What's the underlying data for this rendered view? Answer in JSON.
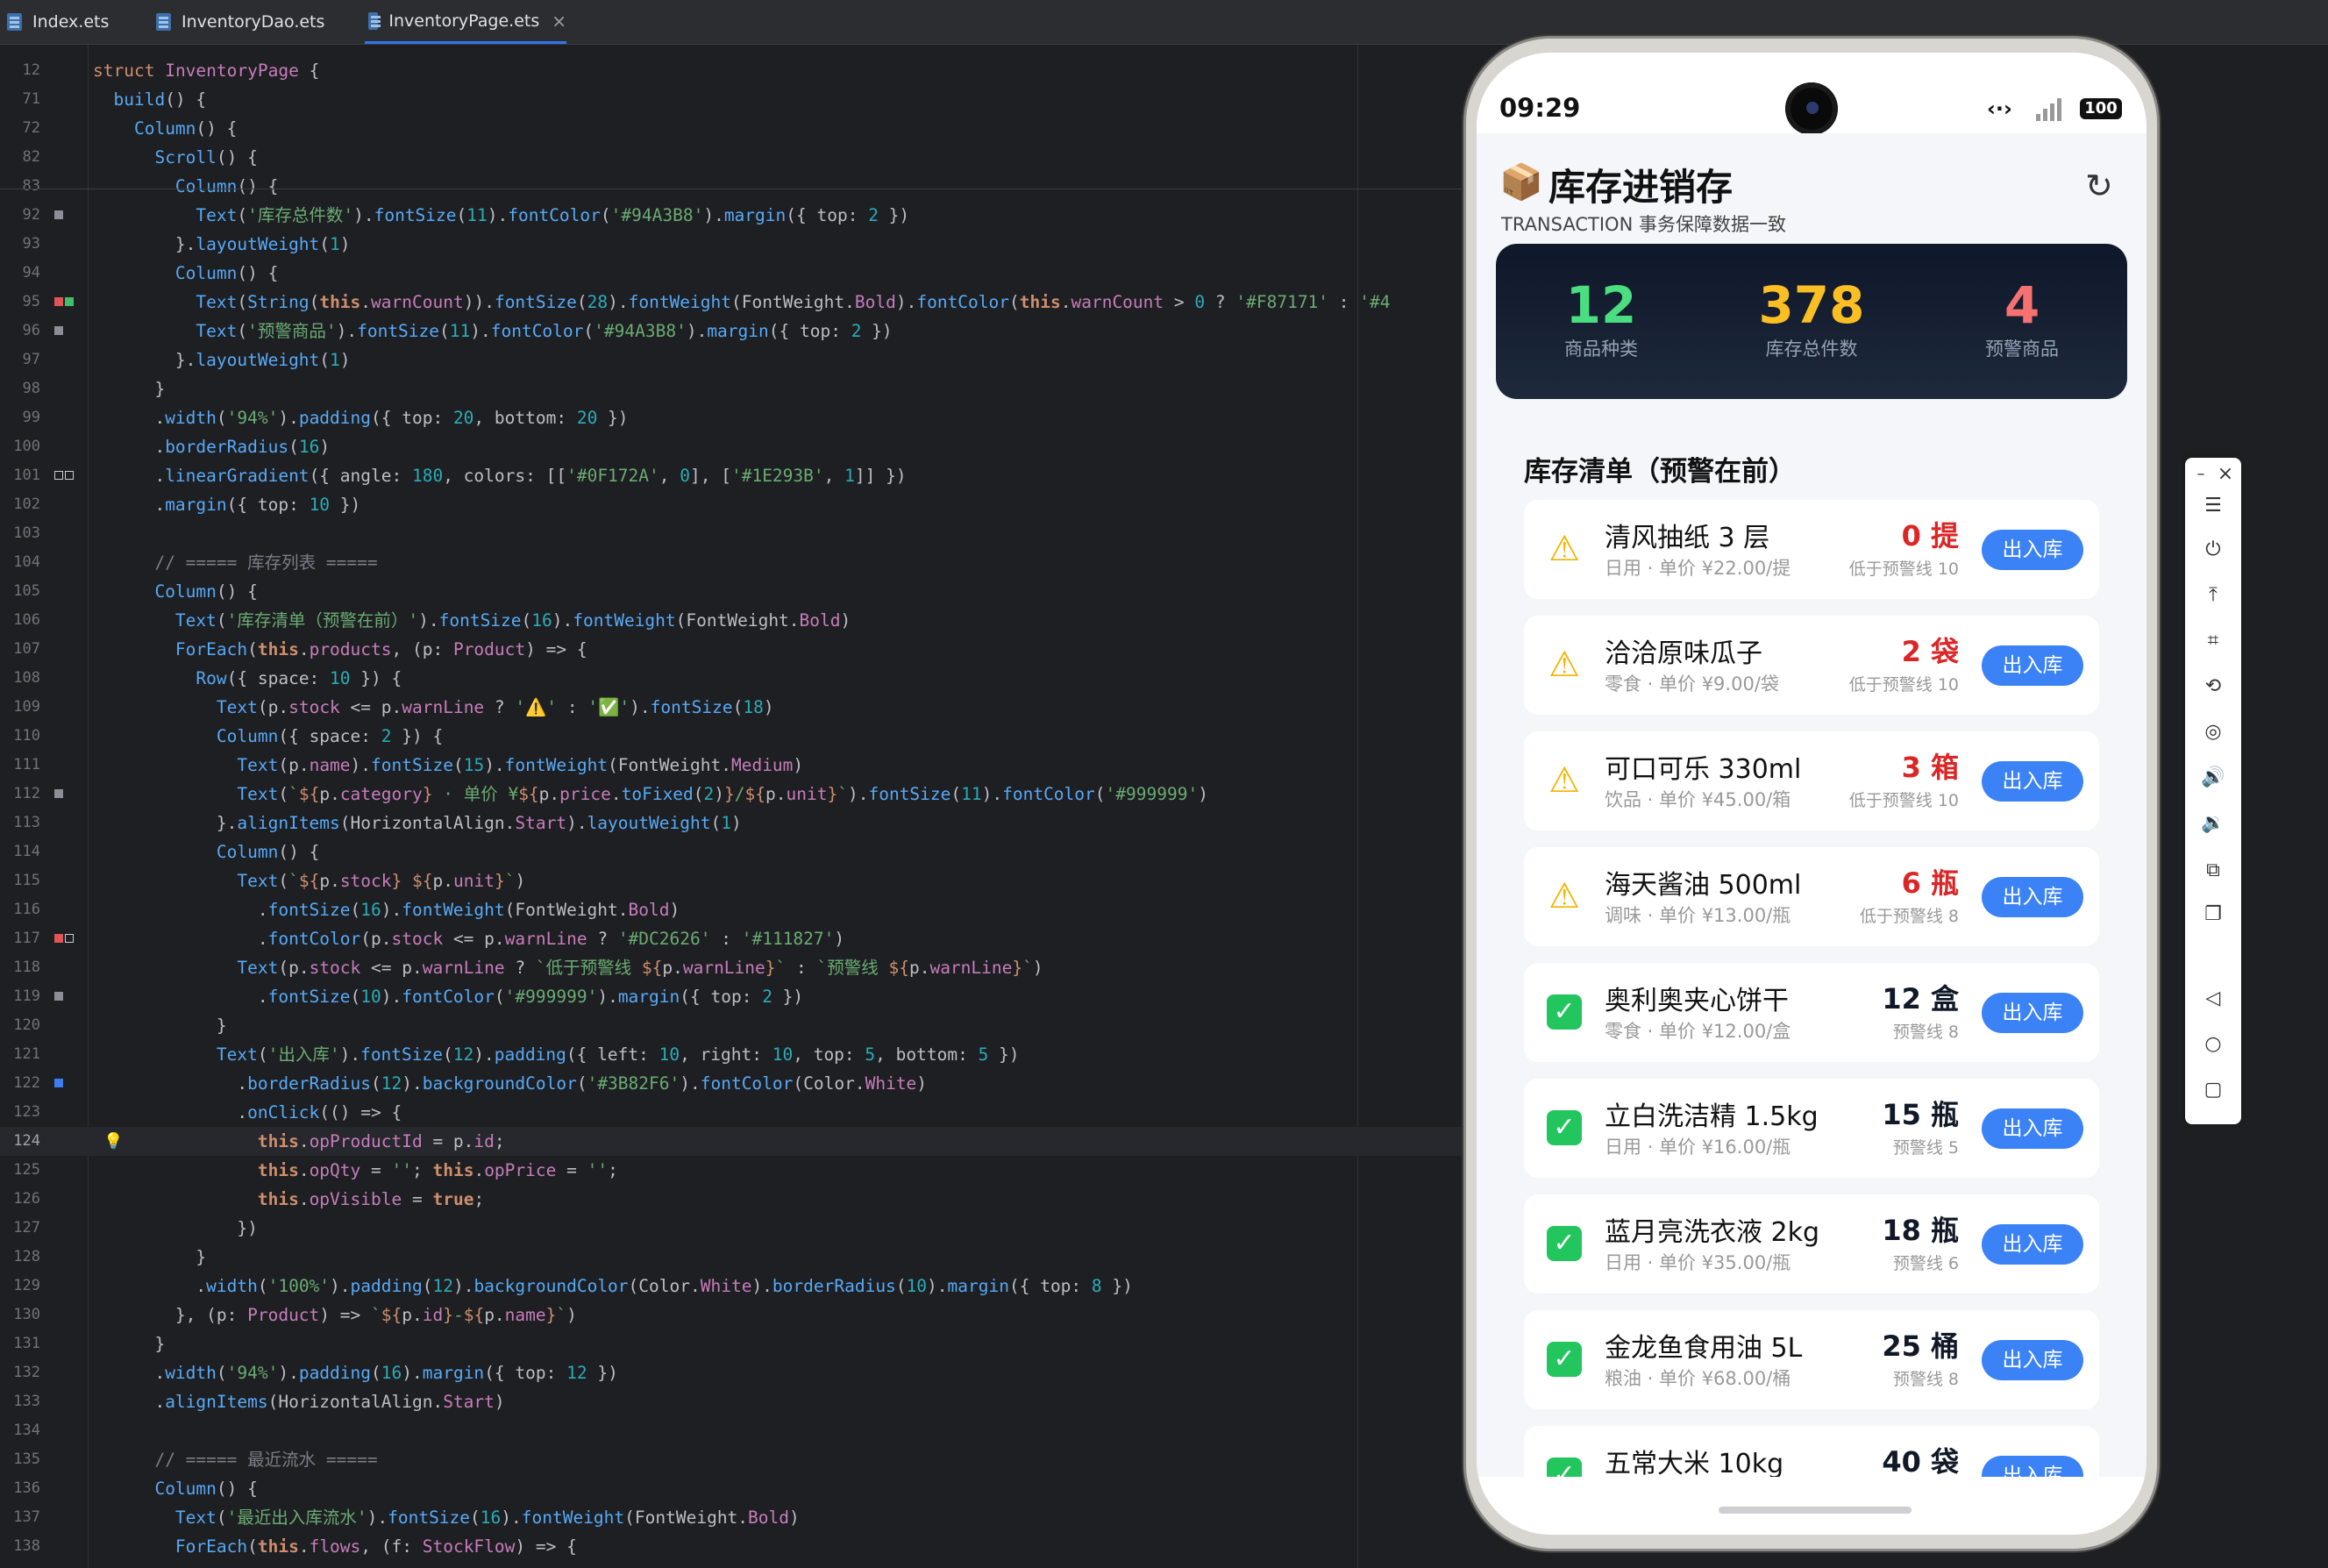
{
  "tabs": [
    {
      "label": "Index.ets",
      "active": false
    },
    {
      "label": "InventoryDao.ets",
      "active": false
    },
    {
      "label": "InventoryPage.ets",
      "active": true
    }
  ],
  "tab_close": "×",
  "editor": {
    "lines": [
      {
        "n": "12",
        "html": "<span class='kw'>struct</span> <span class='ty'>InventoryPage</span> {"
      },
      {
        "n": "71",
        "html": "  <span class='mt'>build</span>() {"
      },
      {
        "n": "72",
        "html": "    <span class='fn'>Column</span>() {"
      },
      {
        "n": "82",
        "html": "      <span class='fn'>Scroll</span>() {"
      },
      {
        "n": "83",
        "html": "        <span class='fn'>Column</span>() {"
      },
      {
        "n": "92",
        "html": "          <span class='fn'>Text</span>(<span class='st'>'库存总件数'</span>).<span class='mt'>fontSize</span>(<span class='nu'>11</span>).<span class='mt'>fontColor</span>(<span class='st'>'#94A3B8'</span>).<span class='mt'>margin</span>({ top: <span class='nu'>2</span> })"
      },
      {
        "n": "93",
        "html": "        }.<span class='mt'>layoutWeight</span>(<span class='nu'>1</span>)"
      },
      {
        "n": "94",
        "html": "        <span class='fn'>Column</span>() {"
      },
      {
        "n": "95",
        "html": "          <span class='fn'>Text</span>(<span class='fn'>String</span>(<span class='kb'>this</span>.<span class='pr'>warnCount</span>)).<span class='mt'>fontSize</span>(<span class='nu'>28</span>).<span class='mt'>fontWeight</span>(FontWeight.<span class='pr'>Bold</span>).<span class='mt'>fontColor</span>(<span class='kb'>this</span>.<span class='pr'>warnCount</span> &gt; <span class='nu'>0</span> ? <span class='st'>'#F87171'</span> : <span class='st'>'#4</span>"
      },
      {
        "n": "96",
        "html": "          <span class='fn'>Text</span>(<span class='st'>'预警商品'</span>).<span class='mt'>fontSize</span>(<span class='nu'>11</span>).<span class='mt'>fontColor</span>(<span class='st'>'#94A3B8'</span>).<span class='mt'>margin</span>({ top: <span class='nu'>2</span> })"
      },
      {
        "n": "97",
        "html": "        }.<span class='mt'>layoutWeight</span>(<span class='nu'>1</span>)"
      },
      {
        "n": "98",
        "html": "      }"
      },
      {
        "n": "99",
        "html": "      .<span class='mt'>width</span>(<span class='st'>'94%'</span>).<span class='mt'>padding</span>({ top: <span class='nu'>20</span>, bottom: <span class='nu'>20</span> })"
      },
      {
        "n": "100",
        "html": "      .<span class='mt'>borderRadius</span>(<span class='nu'>16</span>)"
      },
      {
        "n": "101",
        "html": "      .<span class='mt'>linearGradient</span>({ angle: <span class='nu'>180</span>, colors: [[<span class='st'>'#0F172A'</span>, <span class='nu'>0</span>], [<span class='st'>'#1E293B'</span>, <span class='nu'>1</span>]] })"
      },
      {
        "n": "102",
        "html": "      .<span class='mt'>margin</span>({ top: <span class='nu'>10</span> })"
      },
      {
        "n": "103",
        "html": ""
      },
      {
        "n": "104",
        "html": "      <span class='cm'>// ===== 库存列表 =====</span>"
      },
      {
        "n": "105",
        "html": "      <span class='fn'>Column</span>() {"
      },
      {
        "n": "106",
        "html": "        <span class='fn'>Text</span>(<span class='st'>'库存清单（预警在前）'</span>).<span class='mt'>fontSize</span>(<span class='nu'>16</span>).<span class='mt'>fontWeight</span>(FontWeight.<span class='pr'>Bold</span>)"
      },
      {
        "n": "107",
        "html": "        <span class='fn'>ForEach</span>(<span class='kb'>this</span>.<span class='pr'>products</span>, (p: <span class='ty'>Product</span>) =&gt; {"
      },
      {
        "n": "108",
        "html": "          <span class='fn'>Row</span>({ space: <span class='nu'>10</span> }) {"
      },
      {
        "n": "109",
        "html": "            <span class='fn'>Text</span>(p.<span class='pr'>stock</span> &lt;= p.<span class='pr'>warnLine</span> ? <span class='st'>'⚠️'</span> : <span class='st'>'✅'</span>).<span class='mt'>fontSize</span>(<span class='nu'>18</span>)"
      },
      {
        "n": "110",
        "html": "            <span class='fn'>Column</span>({ space: <span class='nu'>2</span> }) {"
      },
      {
        "n": "111",
        "html": "              <span class='fn'>Text</span>(p.<span class='pr'>name</span>).<span class='mt'>fontSize</span>(<span class='nu'>15</span>).<span class='mt'>fontWeight</span>(FontWeight.<span class='pr'>Medium</span>)"
      },
      {
        "n": "112",
        "html": "              <span class='fn'>Text</span>(<span class='st'>`</span><span class='tp'>${</span>p.<span class='pr'>category</span><span class='tp'>}</span><span class='st'> · 单价 ¥</span><span class='tp'>${</span>p.<span class='pr'>price</span>.<span class='mt'>toFixed</span>(<span class='nu'>2</span>)<span class='tp'>}</span><span class='st'>/</span><span class='tp'>${</span>p.<span class='pr'>unit</span><span class='tp'>}</span><span class='st'>`</span>).<span class='mt'>fontSize</span>(<span class='nu'>11</span>).<span class='mt'>fontColor</span>(<span class='st'>'#999999'</span>)"
      },
      {
        "n": "113",
        "html": "            }.<span class='mt'>alignItems</span>(HorizontalAlign.<span class='pr'>Start</span>).<span class='mt'>layoutWeight</span>(<span class='nu'>1</span>)"
      },
      {
        "n": "114",
        "html": "            <span class='fn'>Column</span>() {"
      },
      {
        "n": "115",
        "html": "              <span class='fn'>Text</span>(<span class='st'>`</span><span class='tp'>${</span>p.<span class='pr'>stock</span><span class='tp'>}</span><span class='st'> </span><span class='tp'>${</span>p.<span class='pr'>unit</span><span class='tp'>}</span><span class='st'>`</span>)"
      },
      {
        "n": "116",
        "html": "                .<span class='mt'>fontSize</span>(<span class='nu'>16</span>).<span class='mt'>fontWeight</span>(FontWeight.<span class='pr'>Bold</span>)"
      },
      {
        "n": "117",
        "html": "                .<span class='mt'>fontColor</span>(p.<span class='pr'>stock</span> &lt;= p.<span class='pr'>warnLine</span> ? <span class='st'>'#DC2626'</span> : <span class='st'>'#111827'</span>)"
      },
      {
        "n": "118",
        "html": "              <span class='fn'>Text</span>(p.<span class='pr'>stock</span> &lt;= p.<span class='pr'>warnLine</span> ? <span class='st'>`低于预警线 </span><span class='tp'>${</span>p.<span class='pr'>warnLine</span><span class='tp'>}</span><span class='st'>`</span> : <span class='st'>`预警线 </span><span class='tp'>${</span>p.<span class='pr'>warnLine</span><span class='tp'>}</span><span class='st'>`</span>)"
      },
      {
        "n": "119",
        "html": "                .<span class='mt'>fontSize</span>(<span class='nu'>10</span>).<span class='mt'>fontColor</span>(<span class='st'>'#999999'</span>).<span class='mt'>margin</span>({ top: <span class='nu'>2</span> })"
      },
      {
        "n": "120",
        "html": "            }"
      },
      {
        "n": "121",
        "html": "            <span class='fn'>Text</span>(<span class='st'>'出入库'</span>).<span class='mt'>fontSize</span>(<span class='nu'>12</span>).<span class='mt'>padding</span>({ left: <span class='nu'>10</span>, right: <span class='nu'>10</span>, top: <span class='nu'>5</span>, bottom: <span class='nu'>5</span> })"
      },
      {
        "n": "122",
        "html": "              .<span class='mt'>borderRadius</span>(<span class='nu'>12</span>).<span class='mt'>backgroundColor</span>(<span class='st'>'#3B82F6'</span>).<span class='mt'>fontColor</span>(Color.<span class='pr'>White</span>)"
      },
      {
        "n": "123",
        "html": "              .<span class='mt'>onClick</span>(() =&gt; {"
      },
      {
        "n": "124",
        "html": "                <span class='kb'>this</span>.<span class='pr'>opProductId</span> = p.<span class='pr'>id</span>;"
      },
      {
        "n": "125",
        "html": "                <span class='kb'>this</span>.<span class='pr'>opQty</span> = <span class='st'>''</span>; <span class='kb'>this</span>.<span class='pr'>opPrice</span> = <span class='st'>''</span>;"
      },
      {
        "n": "126",
        "html": "                <span class='kb'>this</span>.<span class='pr'>opVisible</span> = <span class='kb'>true</span>;"
      },
      {
        "n": "127",
        "html": "              })"
      },
      {
        "n": "128",
        "html": "          }"
      },
      {
        "n": "129",
        "html": "          .<span class='mt'>width</span>(<span class='st'>'100%'</span>).<span class='mt'>padding</span>(<span class='nu'>12</span>).<span class='mt'>backgroundColor</span>(Color.<span class='pr'>White</span>).<span class='mt'>borderRadius</span>(<span class='nu'>10</span>).<span class='mt'>margin</span>({ top: <span class='nu'>8</span> })"
      },
      {
        "n": "130",
        "html": "        }, (p: <span class='ty'>Product</span>) =&gt; <span class='st'>`</span><span class='tp'>${</span>p.<span class='pr'>id</span><span class='tp'>}</span><span class='st'>-</span><span class='tp'>${</span>p.<span class='pr'>name</span><span class='tp'>}</span><span class='st'>`</span>)"
      },
      {
        "n": "131",
        "html": "      }"
      },
      {
        "n": "132",
        "html": "      .<span class='mt'>width</span>(<span class='st'>'94%'</span>).<span class='mt'>padding</span>(<span class='nu'>16</span>).<span class='mt'>margin</span>({ top: <span class='nu'>12</span> })"
      },
      {
        "n": "133",
        "html": "      .<span class='mt'>alignItems</span>(HorizontalAlign.<span class='pr'>Start</span>)"
      },
      {
        "n": "134",
        "html": ""
      },
      {
        "n": "135",
        "html": "      <span class='cm'>// ===== 最近流水 =====</span>"
      },
      {
        "n": "136",
        "html": "      <span class='fn'>Column</span>() {"
      },
      {
        "n": "137",
        "html": "        <span class='fn'>Text</span>(<span class='st'>'最近出入库流水'</span>).<span class='mt'>fontSize</span>(<span class='nu'>16</span>).<span class='mt'>fontWeight</span>(FontWeight.<span class='pr'>Bold</span>)"
      },
      {
        "n": "138",
        "html": "        <span class='fn'>ForEach</span>(<span class='kb'>this</span>.<span class='pr'>flows</span>, (f: <span class='ty'>StockFlow</span>) =&gt; {"
      }
    ],
    "current_line": "124"
  },
  "phone": {
    "time": "09:29",
    "battery": "100",
    "data_icon": "‹·›",
    "app": {
      "icon": "📦",
      "title": "库存进销存",
      "subtitle": "TRANSACTION 事务保障数据一致",
      "refresh_icon": "↻"
    },
    "stats": [
      {
        "value": "12",
        "label": "商品种类",
        "color": "#4ADE80"
      },
      {
        "value": "378",
        "label": "库存总件数",
        "color": "#FBBF24"
      },
      {
        "value": "4",
        "label": "预警商品",
        "color": "#F87171"
      }
    ],
    "list_title": "库存清单（预警在前）",
    "button_label": "出入库",
    "items": [
      {
        "status": "warn",
        "icon": "⚠",
        "name": "清风抽纸 3 层",
        "sub": "日用 · 单价 ¥22.00/提",
        "stock": "0 提",
        "warn_text": "低于预警线 10"
      },
      {
        "status": "warn",
        "icon": "⚠",
        "name": "洽洽原味瓜子",
        "sub": "零食 · 单价 ¥9.00/袋",
        "stock": "2 袋",
        "warn_text": "低于预警线 10"
      },
      {
        "status": "warn",
        "icon": "⚠",
        "name": "可口可乐 330ml",
        "sub": "饮品 · 单价 ¥45.00/箱",
        "stock": "3 箱",
        "warn_text": "低于预警线 10"
      },
      {
        "status": "warn",
        "icon": "⚠",
        "name": "海天酱油 500ml",
        "sub": "调味 · 单价 ¥13.00/瓶",
        "stock": "6 瓶",
        "warn_text": "低于预警线 8"
      },
      {
        "status": "ok",
        "icon": "✓",
        "name": "奥利奥夹心饼干",
        "sub": "零食 · 单价 ¥12.00/盒",
        "stock": "12 盒",
        "warn_text": "预警线 8"
      },
      {
        "status": "ok",
        "icon": "✓",
        "name": "立白洗洁精 1.5kg",
        "sub": "日用 · 单价 ¥16.00/瓶",
        "stock": "15 瓶",
        "warn_text": "预警线 5"
      },
      {
        "status": "ok",
        "icon": "✓",
        "name": "蓝月亮洗衣液 2kg",
        "sub": "日用 · 单价 ¥35.00/瓶",
        "stock": "18 瓶",
        "warn_text": "预警线 6"
      },
      {
        "status": "ok",
        "icon": "✓",
        "name": "金龙鱼食用油 5L",
        "sub": "粮油 · 单价 ¥68.00/桶",
        "stock": "25 桶",
        "warn_text": "预警线 8"
      },
      {
        "status": "ok",
        "icon": "✓",
        "name": "五常大米 10kg",
        "sub": "",
        "stock": "40 袋",
        "warn_text": ""
      }
    ],
    "colors": {
      "warn_stock": "#DC2626",
      "ok_stock": "#111827",
      "button": "#3B82F6"
    }
  },
  "emulator_toolbar": {
    "min": "–",
    "close": "×",
    "icons": [
      {
        "name": "menu-icon",
        "glyph": "☰"
      },
      {
        "name": "power-icon",
        "glyph": "⏻"
      },
      {
        "name": "upload-icon",
        "glyph": "⤒"
      },
      {
        "name": "crop-icon",
        "glyph": "⌗"
      },
      {
        "name": "rotate-icon",
        "glyph": "⟲"
      },
      {
        "name": "location-icon",
        "glyph": "◎"
      },
      {
        "name": "volume-up-icon",
        "glyph": "🔊"
      },
      {
        "name": "volume-down-icon",
        "glyph": "🔉"
      },
      {
        "name": "fold-icon",
        "glyph": "⧉"
      },
      {
        "name": "multi-screen-icon",
        "glyph": "❐"
      },
      {
        "name": "back-icon",
        "glyph": "◁"
      },
      {
        "name": "home-icon",
        "glyph": "○"
      },
      {
        "name": "recents-icon",
        "glyph": "▢"
      }
    ]
  }
}
